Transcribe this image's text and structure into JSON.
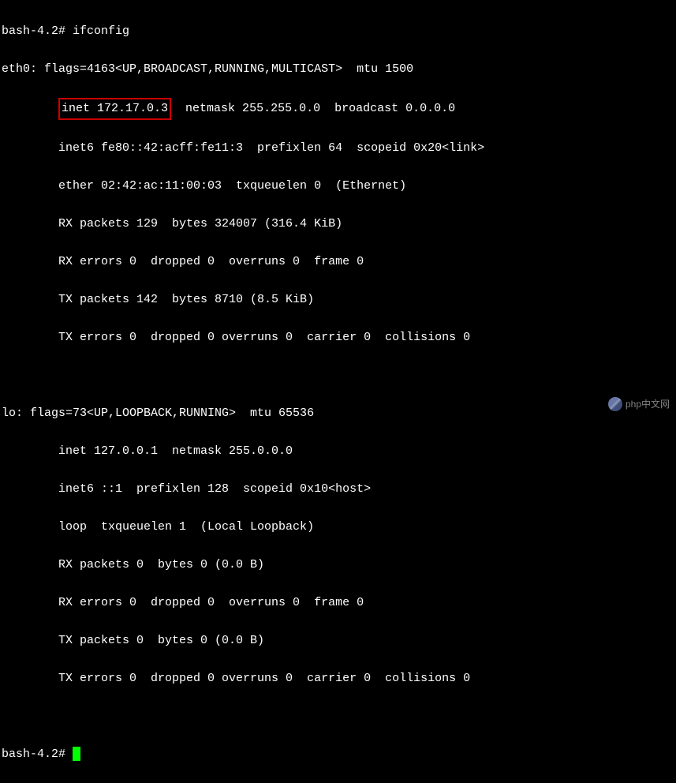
{
  "prompt1_prefix": "bash-4.2# ",
  "command": "ifconfig",
  "eth0": {
    "header": "eth0: flags=4163<UP,BROADCAST,RUNNING,MULTICAST>  mtu 1500",
    "inet_highlight": "inet 172.17.0.3",
    "inet_rest": "  netmask 255.255.0.0  broadcast 0.0.0.0",
    "inet6": "        inet6 fe80::42:acff:fe11:3  prefixlen 64  scopeid 0x20<link>",
    "ether": "        ether 02:42:ac:11:00:03  txqueuelen 0  (Ethernet)",
    "rx_packets": "        RX packets 129  bytes 324007 (316.4 KiB)",
    "rx_errors": "        RX errors 0  dropped 0  overruns 0  frame 0",
    "tx_packets": "        TX packets 142  bytes 8710 (8.5 KiB)",
    "tx_errors": "        TX errors 0  dropped 0 overruns 0  carrier 0  collisions 0"
  },
  "lo": {
    "header": "lo: flags=73<UP,LOOPBACK,RUNNING>  mtu 65536",
    "inet": "        inet 127.0.0.1  netmask 255.0.0.0",
    "inet6": "        inet6 ::1  prefixlen 128  scopeid 0x10<host>",
    "loop": "        loop  txqueuelen 1  (Local Loopback)",
    "rx_packets": "        RX packets 0  bytes 0 (0.0 B)",
    "rx_errors": "        RX errors 0  dropped 0  overruns 0  frame 0",
    "tx_packets": "        TX packets 0  bytes 0 (0.0 B)",
    "tx_errors": "        TX errors 0  dropped 0 overruns 0  carrier 0  collisions 0"
  },
  "prompt2": "bash-4.2# ",
  "watermark_text": "php中文网"
}
